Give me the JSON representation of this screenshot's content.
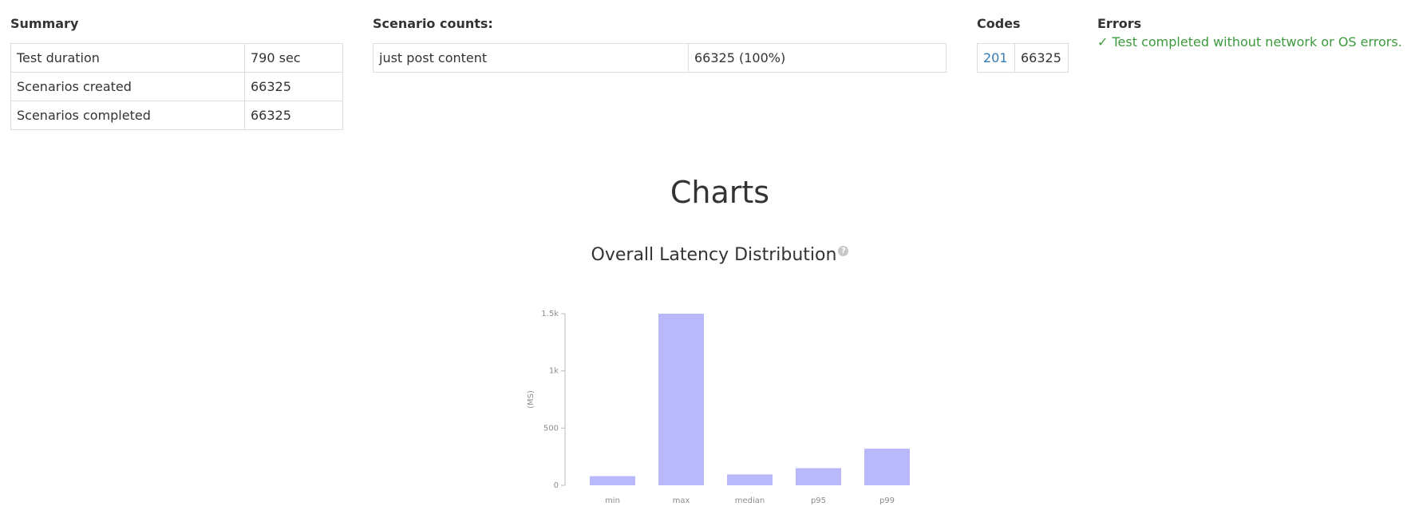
{
  "summary": {
    "heading": "Summary",
    "rows": [
      {
        "label": "Test duration",
        "value": "790 sec"
      },
      {
        "label": "Scenarios created",
        "value": "66325"
      },
      {
        "label": "Scenarios completed",
        "value": "66325"
      }
    ]
  },
  "scenario_counts": {
    "heading": "Scenario counts:",
    "rows": [
      {
        "label": "just post content",
        "value": "66325 (100%)"
      }
    ]
  },
  "codes": {
    "heading": "Codes",
    "rows": [
      {
        "code": "201",
        "count": "66325"
      }
    ]
  },
  "errors": {
    "heading": "Errors",
    "message": "✓ Test completed without network or OS errors."
  },
  "charts": {
    "title": "Charts",
    "help_icon": "question-circle-icon"
  },
  "colors": {
    "bar": "#b8b8fb",
    "success": "#3c9a3c",
    "link": "#337ab7"
  },
  "chart_data": {
    "type": "bar",
    "title": "Overall Latency Distribution",
    "ylabel": "(MS)",
    "xlabel": "",
    "categories": [
      "min",
      "max",
      "median",
      "p95",
      "p99"
    ],
    "values": [
      80,
      1500,
      95,
      150,
      320
    ],
    "ylim": [
      0,
      1500
    ],
    "yticks": [
      0,
      500,
      1000,
      1500
    ],
    "ytick_labels": [
      "0",
      "500",
      "1k",
      "1.5k"
    ],
    "grid": false,
    "legend": "none"
  }
}
